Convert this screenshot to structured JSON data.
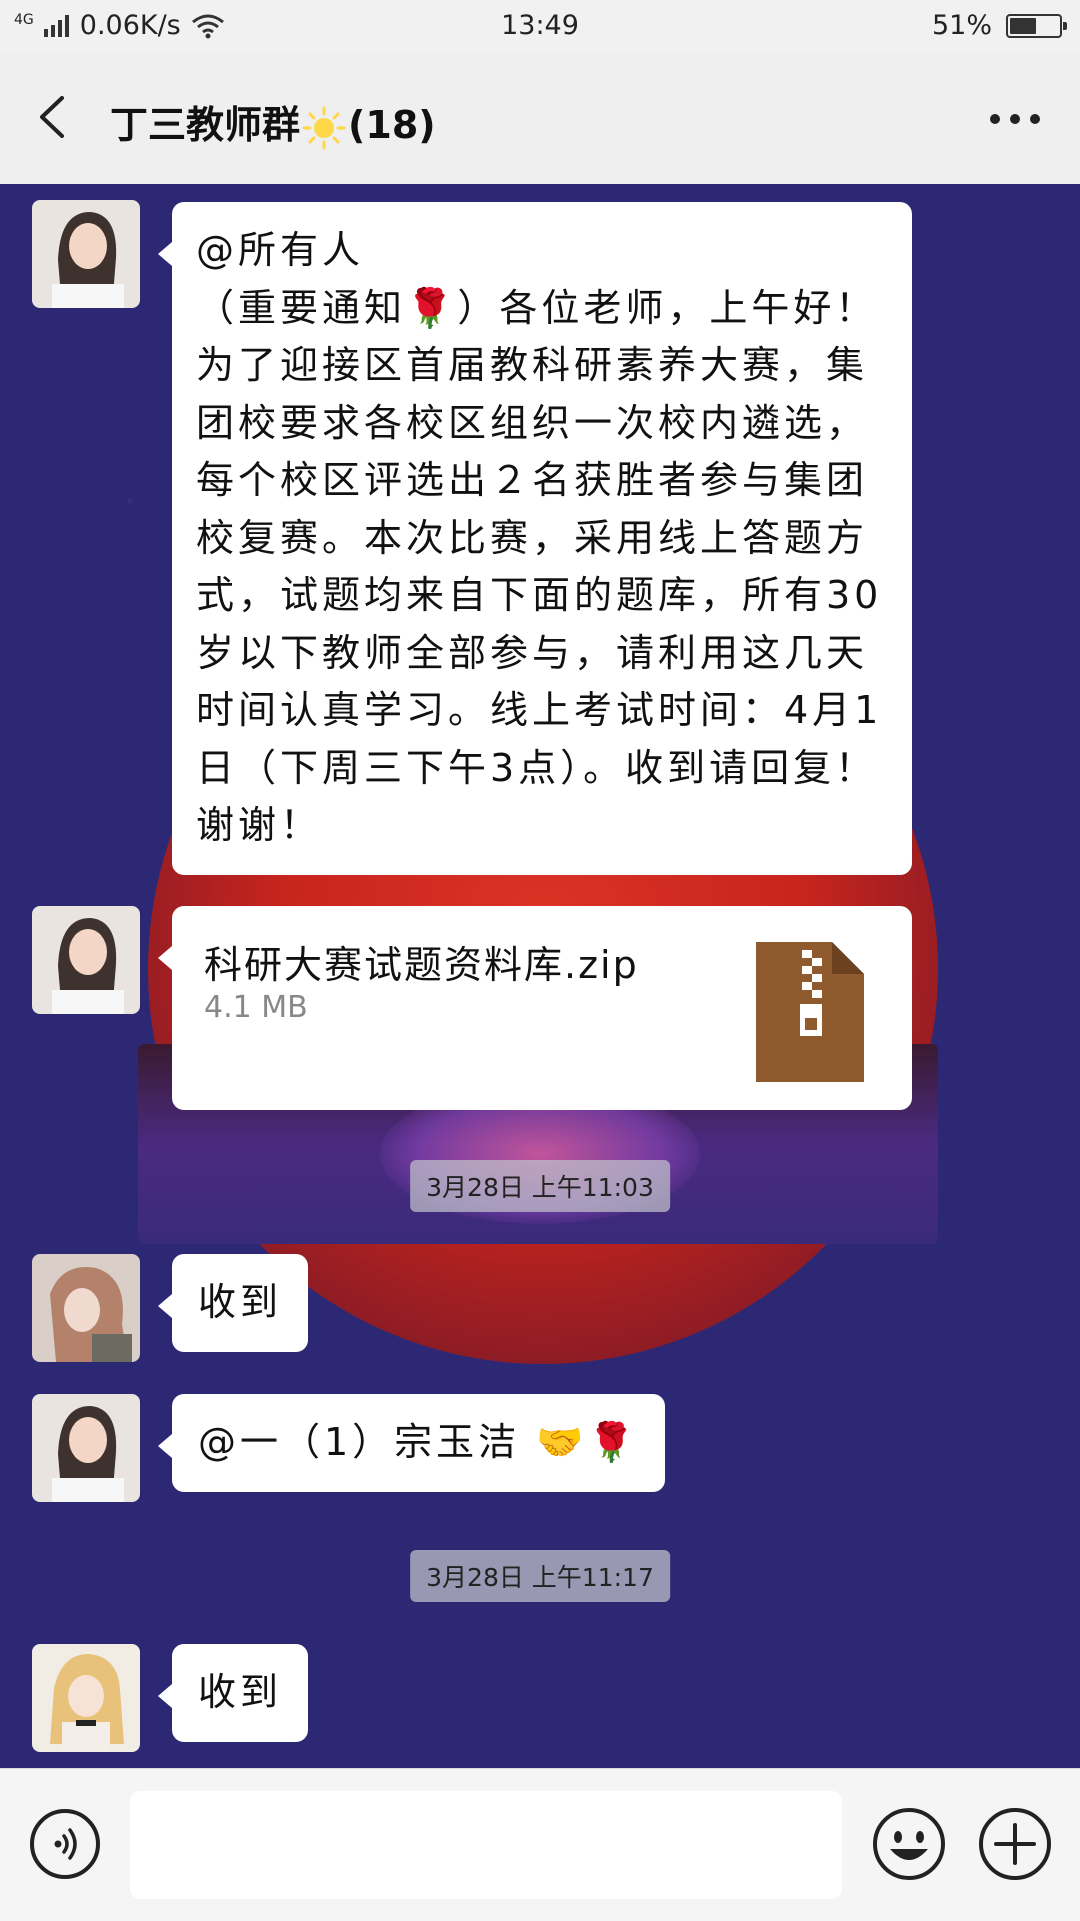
{
  "status_bar": {
    "network": "4G",
    "speed": "0.06K/s",
    "time": "13:49",
    "battery": "51%"
  },
  "header": {
    "title_prefix": "丁三教师群",
    "title_suffix": "(18)"
  },
  "messages": [
    {
      "type": "text",
      "text": "@所有人\n（重要通知🌹）各位老师，上午好！为了迎接区首届教科研素养大赛，集团校要求各校区组织一次校内遴选，每个校区评选出２名获胜者参与集团校复赛。本次比赛，采用线上答题方式，试题均来自下面的题库，所有30岁以下教师全部参与，请利用这几天时间认真学习。线上考试时间：4月1日（下周三下午3点）。收到请回复！谢谢！"
    },
    {
      "type": "file",
      "file_name": "科研大赛试题资料库.zip",
      "file_size": "4.1 MB"
    },
    {
      "type": "timestamp",
      "text": "3月28日 上午11:03"
    },
    {
      "type": "text",
      "text": "收到"
    },
    {
      "type": "text",
      "text": "@一（1）宗玉洁 🤝🌹"
    },
    {
      "type": "timestamp",
      "text": "3月28日 上午11:17"
    },
    {
      "type": "text",
      "text": "收到"
    }
  ],
  "input": {
    "placeholder": ""
  },
  "colors": {
    "chat_background": "#2c2874",
    "bubble": "#ffffff",
    "zip_icon": "#8e5a2e"
  }
}
